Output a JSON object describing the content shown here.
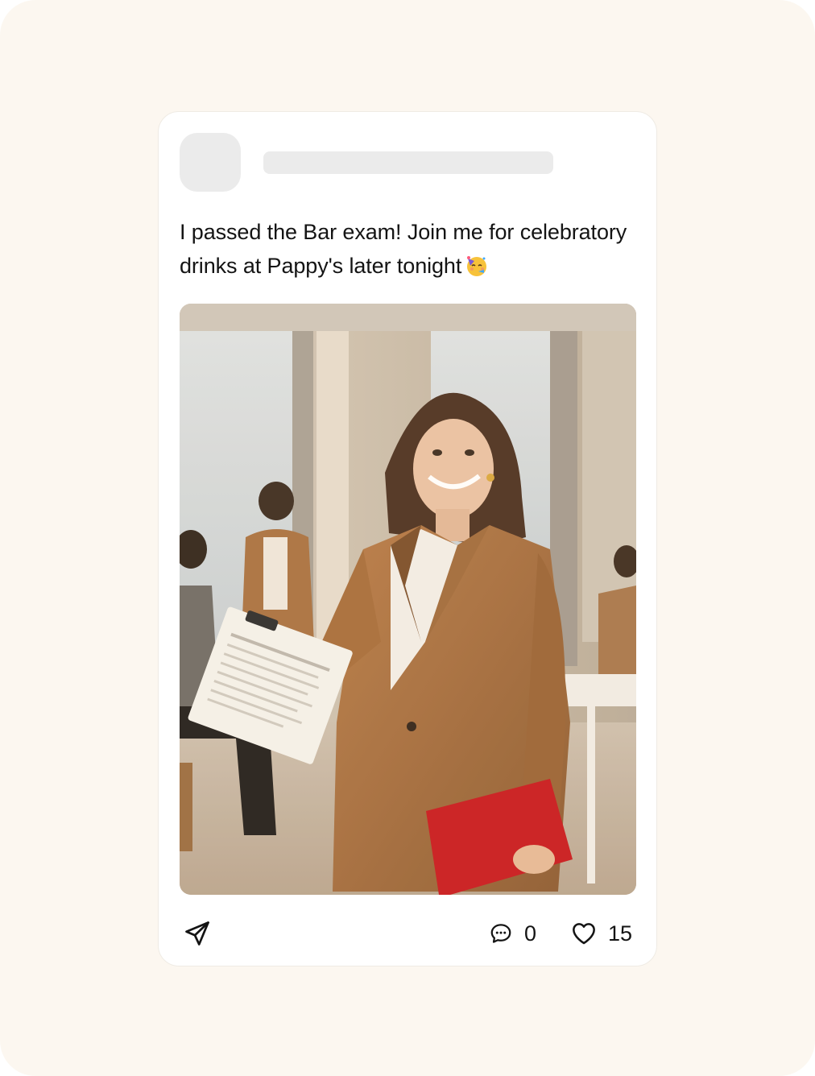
{
  "post": {
    "text": "I passed the Bar exam! Join me for celebratory drinks at Pappy's later tonight",
    "emoji": "partying-face-icon",
    "photo": "woman-in-brown-suit-holding-contract-in-office"
  },
  "actions": {
    "share_icon": "send-icon",
    "comment_icon": "comment-icon",
    "comment_count": "0",
    "like_icon": "heart-icon",
    "like_count": "15"
  },
  "colors": {
    "page_background": "#fcf7f0",
    "card_background": "#ffffff",
    "placeholder": "#ebebeb",
    "text": "#141414"
  }
}
